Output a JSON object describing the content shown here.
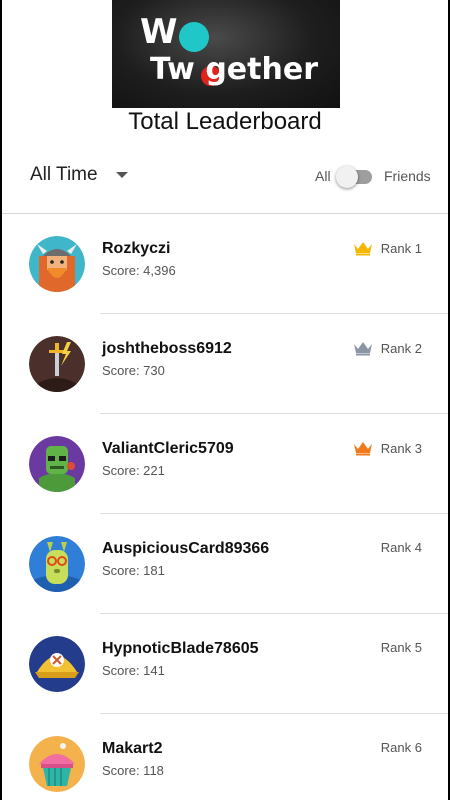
{
  "logo": {
    "line1": "W",
    "line2": "Tw gether"
  },
  "title": "Total Leaderboard",
  "filter": {
    "time": "All Time",
    "toggle_left": "All",
    "toggle_right": "Friends"
  },
  "colors": {
    "gold": "#f5b800",
    "silver": "#8a96a6",
    "bronze": "#f07a1a"
  },
  "players": [
    {
      "name": "Rozkyczi",
      "score": "Score: 4,396",
      "rank": "Rank 1",
      "crown": "gold-crown-icon"
    },
    {
      "name": "joshtheboss6912",
      "score": "Score: 730",
      "rank": "Rank 2",
      "crown": "silver-crown-icon"
    },
    {
      "name": "ValiantCleric5709",
      "score": "Score: 221",
      "rank": "Rank 3",
      "crown": "bronze-crown-icon"
    },
    {
      "name": "AuspiciousCard89366",
      "score": "Score: 181",
      "rank": "Rank 4"
    },
    {
      "name": "HypnoticBlade78605",
      "score": "Score: 141",
      "rank": "Rank 5"
    },
    {
      "name": "Makart2",
      "score": "Score: 118",
      "rank": "Rank 6"
    }
  ]
}
